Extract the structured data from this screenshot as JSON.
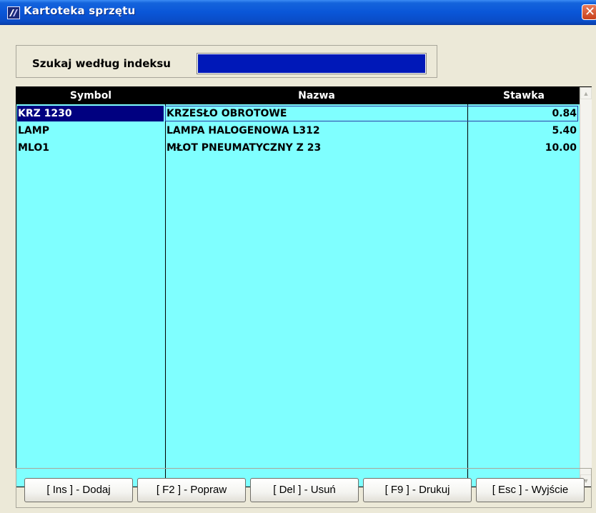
{
  "window": {
    "title": "Kartoteka sprzętu",
    "close_glyph": "✕"
  },
  "search": {
    "label": "Szukaj według indeksu",
    "value": ""
  },
  "table": {
    "columns": [
      "Symbol",
      "Nazwa",
      "Stawka"
    ],
    "rows": [
      {
        "symbol": "KRZ 1230",
        "nazwa": "KRZESŁO OBROTOWE",
        "stawka": "0.84"
      },
      {
        "symbol": "LAMP",
        "nazwa": "LAMPA HALOGENOWA L312",
        "stawka": "5.40"
      },
      {
        "symbol": "MLO1",
        "nazwa": "MŁOT PNEUMATYCZNY Z 23",
        "stawka": "10.00"
      }
    ],
    "selected_row": 0
  },
  "buttons": {
    "add": "[ Ins ] - Dodaj",
    "edit": "[ F2 ] - Popraw",
    "delete": "[ Del ] - Usuń",
    "print": "[ F9 ] - Drukuj",
    "exit": "[ Esc ] - Wyjście"
  },
  "icons": {
    "app": "app-logo-icon",
    "close": "close-icon",
    "scroll_up": "scroll-up-arrow-icon",
    "scroll_down": "scroll-down-arrow-icon"
  },
  "colors": {
    "grid_background": "#7fffff",
    "header_background": "#000000",
    "selection": "#000080",
    "search_field": "#0018b8",
    "title_bar": "#0a56d8"
  }
}
